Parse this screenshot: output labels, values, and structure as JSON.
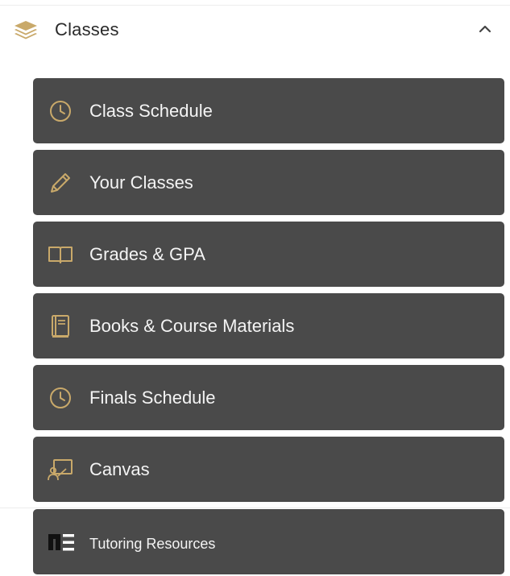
{
  "section": {
    "title": "Classes",
    "header_icon": "layers-icon",
    "toggle_icon": "chevron-up-icon",
    "accent_color": "#c9a96a"
  },
  "menu": {
    "item_background": "#4a4a4a",
    "item_text_color": "#f4f4f4",
    "items": [
      {
        "label": "Class Schedule",
        "icon": "clock-icon"
      },
      {
        "label": "Your Classes",
        "icon": "pencil-icon"
      },
      {
        "label": "Grades & GPA",
        "icon": "book-open-icon"
      },
      {
        "label": "Books & Course Materials",
        "icon": "book-icon"
      },
      {
        "label": "Finals Schedule",
        "icon": "clock-icon"
      },
      {
        "label": "Canvas",
        "icon": "presentation-icon"
      },
      {
        "label": "Tutoring Resources",
        "icon": "tutoring-logo-icon"
      }
    ]
  }
}
